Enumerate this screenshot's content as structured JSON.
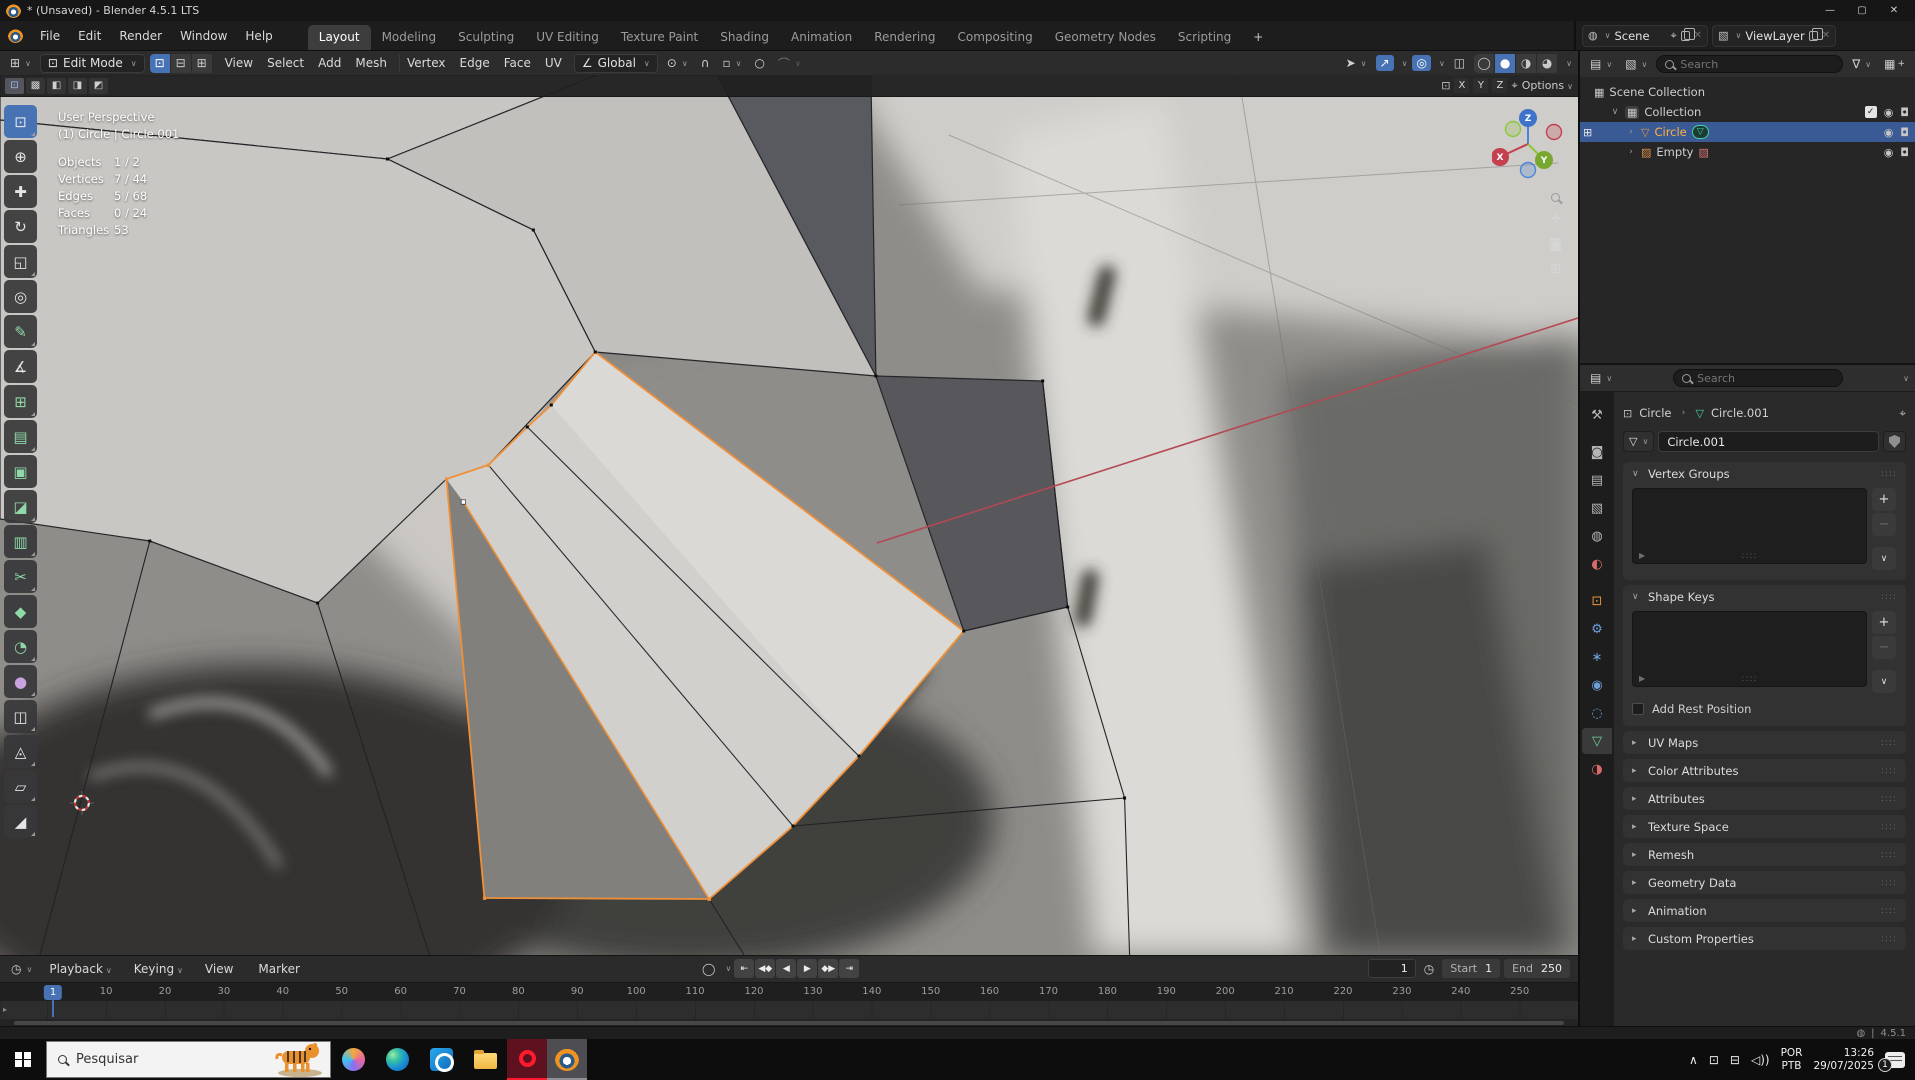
{
  "colors": {
    "accent_blue": "#4772b3",
    "selection_orange": "#ef9038",
    "axis_red": "#b44853",
    "active_object_orange": "#ffb244",
    "mesh_data_teal": "#3fd0a8",
    "tool_green": "#8fd9a8",
    "tool_purple": "#c9a3e0",
    "tab_green": "#6fd19e",
    "tint_blue": "#6f9fd8",
    "tint_red": "#d96a6a",
    "tint_orange": "#e8913c",
    "opera_red": "#ff1b2d",
    "blender_orange": "#f09322"
  },
  "icons": {
    "editor_grid": "⊞",
    "vertex_cube": "⊡",
    "orientation_axes": "∠",
    "pivot": "⊙",
    "magnet": "∩",
    "snap_target": "▫",
    "proportional_circle": "○",
    "falloff_curve": "⌒",
    "visibility_cursor": "➤",
    "gizmos_arrow": "↗",
    "overlays_circles": "◎",
    "xray_square": "◫",
    "clock": "◷",
    "autokey_circle": "◯",
    "scene": "◍",
    "viewlayer": "▧",
    "pin": "⌖",
    "close_x": "✕",
    "collection_box": "▦",
    "mesh_triangle": "▽",
    "image_data": "▨",
    "eye": "◉",
    "camera": "◘",
    "check": "✓",
    "funnel": "∇",
    "display_mode": "▤",
    "filter_type": "▧",
    "new_collection": "▦",
    "editmode_dots": "⊞",
    "breadcrumb_sep": "›",
    "object_box": "⊡",
    "panel_open": "∨",
    "panel_closed": "▸",
    "grip": "::::",
    "list_arrow": "▶",
    "plus": "+",
    "minus": "−",
    "drop": "∨",
    "globe": "◍",
    "statusbar_sep": "|",
    "tray_chevron": "∧",
    "tray_app": "⊡",
    "tray_network": "⊟",
    "tray_volume": "◁))",
    "mirror_box": "⊡",
    "mirror_snap": "⌖",
    "caret": "∨",
    "pan_cross": "✛",
    "ortho_grid": "⊞",
    "nav_camera": "◙"
  },
  "titlebar": {
    "title": "* (Unsaved) - Blender 4.5.1 LTS",
    "minimize": "—",
    "maximize": "▢",
    "close": "✕"
  },
  "topbar": {
    "menus": [
      {
        "name": "menu-file",
        "label": "File"
      },
      {
        "name": "menu-edit",
        "label": "Edit"
      },
      {
        "name": "menu-render",
        "label": "Render"
      },
      {
        "name": "menu-window",
        "label": "Window"
      },
      {
        "name": "menu-help",
        "label": "Help"
      }
    ],
    "workspaces": [
      {
        "name": "workspace-layout",
        "label": "Layout",
        "active": true
      },
      {
        "name": "workspace-modeling",
        "label": "Modeling"
      },
      {
        "name": "workspace-sculpting",
        "label": "Sculpting"
      },
      {
        "name": "workspace-uv-editing",
        "label": "UV Editing"
      },
      {
        "name": "workspace-texture-paint",
        "label": "Texture Paint"
      },
      {
        "name": "workspace-shading",
        "label": "Shading"
      },
      {
        "name": "workspace-animation",
        "label": "Animation"
      },
      {
        "name": "workspace-rendering",
        "label": "Rendering"
      },
      {
        "name": "workspace-compositing",
        "label": "Compositing"
      },
      {
        "name": "workspace-geometry-nodes",
        "label": "Geometry Nodes"
      },
      {
        "name": "workspace-scripting",
        "label": "Scripting"
      }
    ],
    "add_workspace": "+",
    "scene_label": "Scene",
    "viewlayer_label": "ViewLayer"
  },
  "toolheader": {
    "mode_label": "Edit Mode",
    "select_modes": [
      {
        "name": "vertex-select-mode",
        "glyph": "⊡",
        "active": true
      },
      {
        "name": "edge-select-mode",
        "glyph": "⊟"
      },
      {
        "name": "face-select-mode",
        "glyph": "⊞"
      }
    ],
    "menus": [
      {
        "name": "menu-view",
        "label": "View"
      },
      {
        "name": "menu-select",
        "label": "Select"
      },
      {
        "name": "menu-add",
        "label": "Add"
      },
      {
        "name": "menu-mesh",
        "label": "Mesh"
      }
    ],
    "mesh_menus": [
      {
        "name": "menu-vertex",
        "label": "Vertex"
      },
      {
        "name": "menu-edge",
        "label": "Edge"
      },
      {
        "name": "menu-face",
        "label": "Face"
      },
      {
        "name": "menu-uv",
        "label": "UV"
      }
    ],
    "orientation_label": "Global",
    "shading_modes": [
      {
        "name": "wireframe-shading",
        "glyph": "◯"
      },
      {
        "name": "solid-shading",
        "glyph": "●",
        "active": true
      },
      {
        "name": "material-preview-shading",
        "glyph": "◑"
      },
      {
        "name": "rendered-shading",
        "glyph": "◕"
      }
    ]
  },
  "tool_settings_modes": [
    {
      "name": "select-mode-new",
      "glyph": "⊡",
      "active": true
    },
    {
      "name": "select-mode-extend",
      "glyph": "▩"
    },
    {
      "name": "select-mode-subtract",
      "glyph": "◧"
    },
    {
      "name": "select-mode-invert",
      "glyph": "◨"
    },
    {
      "name": "select-mode-intersect",
      "glyph": "◩"
    }
  ],
  "toolbar": {
    "tools": [
      {
        "name": "tool-select-box",
        "glyph": "⊡",
        "active": true,
        "sub": true
      },
      {
        "name": "tool-cursor",
        "glyph": "⊕"
      },
      {
        "name": "tool-move",
        "glyph": "✚"
      },
      {
        "name": "tool-rotate",
        "glyph": "↻"
      },
      {
        "name": "tool-scale",
        "glyph": "◱",
        "sub": true
      },
      {
        "name": "tool-transform",
        "glyph": "◎"
      },
      {
        "name": "tool-annotate",
        "glyph": "✎",
        "tint": "green",
        "sub": true
      },
      {
        "name": "tool-measure",
        "glyph": "∡"
      },
      {
        "name": "tool-add-cube",
        "glyph": "⊞",
        "tint": "green",
        "sub": true
      },
      {
        "name": "tool-extrude-region",
        "glyph": "▤",
        "tint": "green",
        "sub": true
      },
      {
        "name": "tool-inset-faces",
        "glyph": "▣",
        "tint": "green"
      },
      {
        "name": "tool-bevel",
        "glyph": "◪",
        "tint": "green",
        "sub": true
      },
      {
        "name": "tool-loop-cut",
        "glyph": "▥",
        "tint": "green",
        "sub": true
      },
      {
        "name": "tool-knife",
        "glyph": "✂",
        "tint": "green",
        "sub": true
      },
      {
        "name": "tool-poly-build",
        "glyph": "◆",
        "tint": "green"
      },
      {
        "name": "tool-spin",
        "glyph": "◔",
        "tint": "green",
        "sub": true
      },
      {
        "name": "tool-smooth",
        "glyph": "●",
        "tint": "purple",
        "sub": true
      },
      {
        "name": "tool-edge-slide",
        "glyph": "◫",
        "sub": true
      },
      {
        "name": "tool-shrink-fatten",
        "glyph": "◬",
        "sub": true
      },
      {
        "name": "tool-shear",
        "glyph": "▱",
        "sub": true
      },
      {
        "name": "tool-rip-region",
        "glyph": "◢",
        "sub": true
      }
    ]
  },
  "viewport": {
    "view_name": "User Perspective",
    "object_path": "(1) Circle | Circle.001",
    "stats": [
      {
        "label": "Objects",
        "value": "1 / 2"
      },
      {
        "label": "Vertices",
        "value": "7 / 44"
      },
      {
        "label": "Edges",
        "value": "5 / 68"
      },
      {
        "label": "Faces",
        "value": "0 / 24"
      },
      {
        "label": "Triangles",
        "value": "53"
      }
    ],
    "mirror": {
      "x": "X",
      "y": "Y",
      "z": "Z",
      "options_label": "Options"
    },
    "gizmo": {
      "x": "X",
      "y": "Y",
      "z": "Z"
    }
  },
  "outliner": {
    "search_placeholder": "Search",
    "rows": [
      {
        "label": "Scene Collection"
      },
      {
        "label": "Collection"
      },
      {
        "label": "Circle"
      },
      {
        "label": "Empty"
      }
    ]
  },
  "properties": {
    "search_placeholder": "Search",
    "tabs": [
      {
        "name": "tab-tool",
        "glyph": "⚒"
      },
      {
        "name": "tab-render",
        "glyph": "◙"
      },
      {
        "name": "tab-output",
        "glyph": "▤"
      },
      {
        "name": "tab-view-layer",
        "glyph": "▧"
      },
      {
        "name": "tab-scene",
        "glyph": "◍"
      },
      {
        "name": "tab-world",
        "glyph": "◐",
        "tint": "red"
      },
      {
        "name": "tab-object",
        "glyph": "⊡",
        "tint": "orange"
      },
      {
        "name": "tab-modifiers",
        "glyph": "⚙",
        "tint": "blue"
      },
      {
        "name": "tab-particles",
        "glyph": "∗",
        "tint": "blue"
      },
      {
        "name": "tab-physics",
        "glyph": "◉",
        "tint": "blue"
      },
      {
        "name": "tab-constraints",
        "glyph": "◌",
        "tint": "blue"
      },
      {
        "name": "tab-data",
        "glyph": "▽",
        "tint": "green",
        "active": true
      },
      {
        "name": "tab-material",
        "glyph": "◑",
        "tint": "red"
      }
    ],
    "breadcrumb": {
      "object": "Circle",
      "data": "Circle.001"
    },
    "name_value": "Circle.001",
    "vertex_groups_title": "Vertex Groups",
    "shape_keys_title": "Shape Keys",
    "add_rest_label": "Add Rest Position",
    "collapsed": [
      {
        "name": "panel-uv-maps",
        "title": "UV Maps"
      },
      {
        "name": "panel-color-attributes",
        "title": "Color Attributes"
      },
      {
        "name": "panel-attributes",
        "title": "Attributes"
      },
      {
        "name": "panel-texture-space",
        "title": "Texture Space"
      },
      {
        "name": "panel-remesh",
        "title": "Remesh"
      },
      {
        "name": "panel-geometry-data",
        "title": "Geometry Data"
      },
      {
        "name": "panel-animation",
        "title": "Animation"
      },
      {
        "name": "panel-custom-properties",
        "title": "Custom Properties"
      }
    ]
  },
  "timeline": {
    "menus": [
      {
        "name": "timeline-menu-playback",
        "label": "Playback",
        "caret": "∨"
      },
      {
        "name": "timeline-menu-keying",
        "label": "Keying",
        "caret": "∨"
      },
      {
        "name": "timeline-menu-view",
        "label": "View"
      },
      {
        "name": "timeline-menu-marker",
        "label": "Marker"
      }
    ],
    "transport": [
      {
        "name": "jump-to-start-button",
        "glyph": "⇤"
      },
      {
        "name": "previous-keyframe-button",
        "glyph": "◀◆"
      },
      {
        "name": "play-reverse-button",
        "glyph": "◀"
      },
      {
        "name": "play-button",
        "glyph": "▶"
      },
      {
        "name": "next-keyframe-button",
        "glyph": "◆▶"
      },
      {
        "name": "jump-to-end-button",
        "glyph": "⇥"
      }
    ],
    "frame_value": "1",
    "start_label": "Start",
    "start_value": "1",
    "end_label": "End",
    "end_value": "250",
    "ticks": [
      {
        "label": "1",
        "current": true
      },
      {
        "label": "10"
      },
      {
        "label": "20"
      },
      {
        "label": "30"
      },
      {
        "label": "40"
      },
      {
        "label": "50"
      },
      {
        "label": "60"
      },
      {
        "label": "70"
      },
      {
        "label": "80"
      },
      {
        "label": "90"
      },
      {
        "label": "100"
      },
      {
        "label": "110"
      },
      {
        "label": "120"
      },
      {
        "label": "130"
      },
      {
        "label": "140"
      },
      {
        "label": "150"
      },
      {
        "label": "160"
      },
      {
        "label": "170"
      },
      {
        "label": "180"
      },
      {
        "label": "190"
      },
      {
        "label": "200"
      },
      {
        "label": "210"
      },
      {
        "label": "220"
      },
      {
        "label": "230"
      },
      {
        "label": "240"
      },
      {
        "label": "250"
      }
    ]
  },
  "statusbar": {
    "version": "4.5.1"
  },
  "taskbar": {
    "search_placeholder": "Pesquisar",
    "tray": {
      "lang_top": "POR",
      "lang_bottom": "PTB",
      "time": "13:26",
      "date": "29/07/2025",
      "badge": "1"
    }
  }
}
